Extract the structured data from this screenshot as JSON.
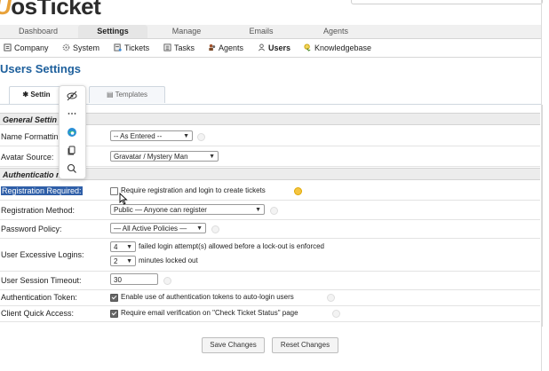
{
  "logo": {
    "prefix": "U",
    "text": "osTicket"
  },
  "topnav": [
    "Dashboard",
    "Settings",
    "Manage",
    "Emails",
    "Agents"
  ],
  "subnav": [
    "Company",
    "System",
    "Tickets",
    "Tasks",
    "Agents",
    "Users",
    "Knowledgebase"
  ],
  "page_title": "Users Settings",
  "tabs": [
    "Settin",
    "Templates"
  ],
  "sections": {
    "general": "General Settin",
    "auth": "Authenticatio      ngs"
  },
  "rows": {
    "name_formatting": {
      "label": "Name Formattin",
      "value": "-- As Entered --"
    },
    "avatar_source": {
      "label": "Avatar Source:",
      "value": "Gravatar / Mystery Man"
    },
    "registration_required": {
      "label": "Registration Required:",
      "checkbox_text": "Require registration and login to create tickets",
      "checked": false
    },
    "registration_method": {
      "label": "Registration Method:",
      "value": "Public — Anyone can register"
    },
    "password_policy": {
      "label": "Password Policy:",
      "value": "— All Active Policies —"
    },
    "excessive_logins": {
      "label": "User Excessive Logins:",
      "attempts": "4",
      "attempts_text": "failed login attempt(s) allowed before a lock-out is enforced",
      "minutes": "2",
      "minutes_text": "minutes locked out"
    },
    "session_timeout": {
      "label": "User Session Timeout:",
      "value": "30"
    },
    "auth_token": {
      "label": "Authentication Token:",
      "checkbox_text": "Enable use of authentication tokens to auto-login users",
      "checked": true
    },
    "quick_access": {
      "label": "Client Quick Access:",
      "checkbox_text": "Require email verification on \"Check Ticket Status\" page",
      "checked": true
    }
  },
  "buttons": {
    "save": "Save Changes",
    "reset": "Reset Changes"
  },
  "popup_icons": [
    "eye-off-icon",
    "more-icon",
    "edge-icon",
    "copy-icon",
    "search-icon"
  ]
}
